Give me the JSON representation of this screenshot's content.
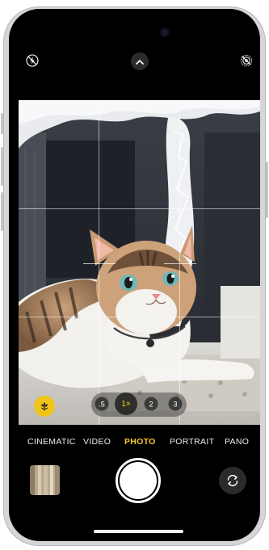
{
  "zoom": {
    "levels": [
      ".5",
      "1×",
      "2",
      "3"
    ],
    "selected": "1×"
  },
  "modes": [
    "CINEMATIC",
    "VIDEO",
    "PHOTO",
    "PORTRAIT",
    "PANO"
  ],
  "selected_mode": "PHOTO",
  "icons": {
    "flash": "flash-off-icon",
    "controls": "chevron-up-icon",
    "live_photo": "live-photo-off-icon",
    "macro": "macro-flower-icon",
    "flip": "camera-flip-icon"
  },
  "colors": {
    "accent": "#f7c92b",
    "background": "#000000"
  }
}
